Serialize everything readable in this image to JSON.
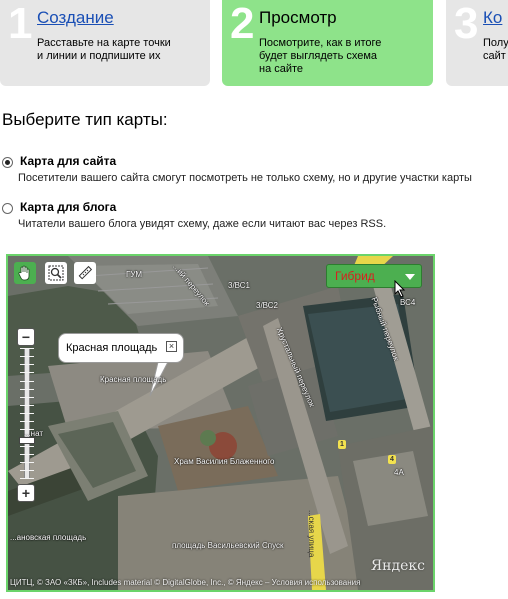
{
  "steps": [
    {
      "number": "1",
      "title": "Создание",
      "desc_line1": "Расставьте на карте точки",
      "desc_line2": "и линии и подпишите их",
      "desc_line3": ""
    },
    {
      "number": "2",
      "title": "Просмотр",
      "desc_line1": "Посмотрите, как в итоге",
      "desc_line2": "будет выглядеть схема",
      "desc_line3": "на сайте"
    },
    {
      "number": "3",
      "title": "Ко",
      "desc_line1": "Полу",
      "desc_line2": "сайт",
      "desc_line3": ""
    }
  ],
  "heading": "Выберите тип карты:",
  "options": [
    {
      "title": "Карта для сайта",
      "desc": "Посетители вашего сайта смогут посмотреть не только схему, но и другие участки карты",
      "selected": true
    },
    {
      "title": "Карта для блога",
      "desc": "Читатели вашего блога увидят схему, даже если читают вас через RSS.",
      "selected": false
    }
  ],
  "map": {
    "layer_label": "Гибрид",
    "balloon_text": "Красная площадь",
    "balloon_close": "×",
    "zoom_in": "+",
    "zoom_out": "−",
    "zoom_level": 0.72,
    "labels": {
      "gum": "ГУМ",
      "b1": "3/ВС1",
      "b2": "3/ВС2",
      "pereulok": "...ий переулок",
      "khrustalny": "Хрустальный переулок",
      "rybny": "Рыбный переулок",
      "krasnaya": "Красная площадь",
      "vasily": "Храм Василия Блаженного",
      "vasilevsky": "площадь Васильевский Спуск",
      "ivanovskaya": "...ановская площадь",
      "senat": "...нат",
      "varvarka": "...ская улица",
      "r1": "1",
      "r4": "4",
      "r4a": "4A",
      "bc4": "ВС4"
    },
    "copyright": "ЦИТЦ, © ЗАО «ЗКБ», Includes material © DigitalGlobe, Inc., © Яндекс – Условия использования",
    "brand": "Яндекс"
  },
  "colors": {
    "accent": "#8ee38a",
    "link": "#1a4fb5",
    "layer_text": "#d81f1f"
  }
}
